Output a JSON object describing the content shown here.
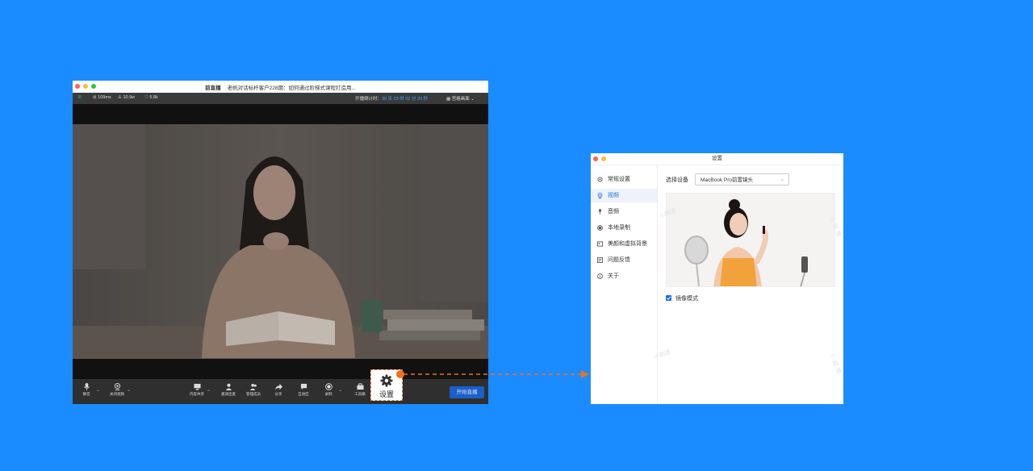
{
  "live_window": {
    "title_app": "前直播",
    "title_topic": "老帆对话标杆客户228期：如何通过阶梯式课程打造用...",
    "status": {
      "signal": "lll",
      "bitrate": "109ms",
      "viewers": "10.9w",
      "likes": "5.8k",
      "countdown_label": "开播倒计时：",
      "countdown": "30 天 23 时 02 分 20 秒",
      "layout_label": "宫格画面"
    },
    "toolbar": {
      "mic": "静音",
      "camera": "关闭视频",
      "share": "内容共享",
      "invite": "邀请连麦",
      "members": "管理成员",
      "forward": "分享",
      "chat": "互动区",
      "record": "录制",
      "tools": "工具箱",
      "start_live": "开始直播"
    },
    "settings_callout": "设置"
  },
  "settings_window": {
    "title": "设置",
    "menu": [
      {
        "label": "常规设置",
        "icon": "gear-icon"
      },
      {
        "label": "视频",
        "icon": "camera-icon"
      },
      {
        "label": "音频",
        "icon": "mic-icon"
      },
      {
        "label": "本地录制",
        "icon": "record-icon"
      },
      {
        "label": "美颜和虚拟背景",
        "icon": "beauty-icon"
      },
      {
        "label": "问题反馈",
        "icon": "feedback-icon"
      },
      {
        "label": "关于",
        "icon": "info-icon"
      }
    ],
    "active_menu": "视频",
    "device_label": "选择设备",
    "device_value": "MacBook Pro前置镜头",
    "mirror_label": "镜像模式",
    "mirror_checked": true,
    "watermark": "小鹅通"
  },
  "colors": {
    "background": "#1a8cff",
    "accent": "#1a6fe0",
    "callout": "#f07020"
  }
}
